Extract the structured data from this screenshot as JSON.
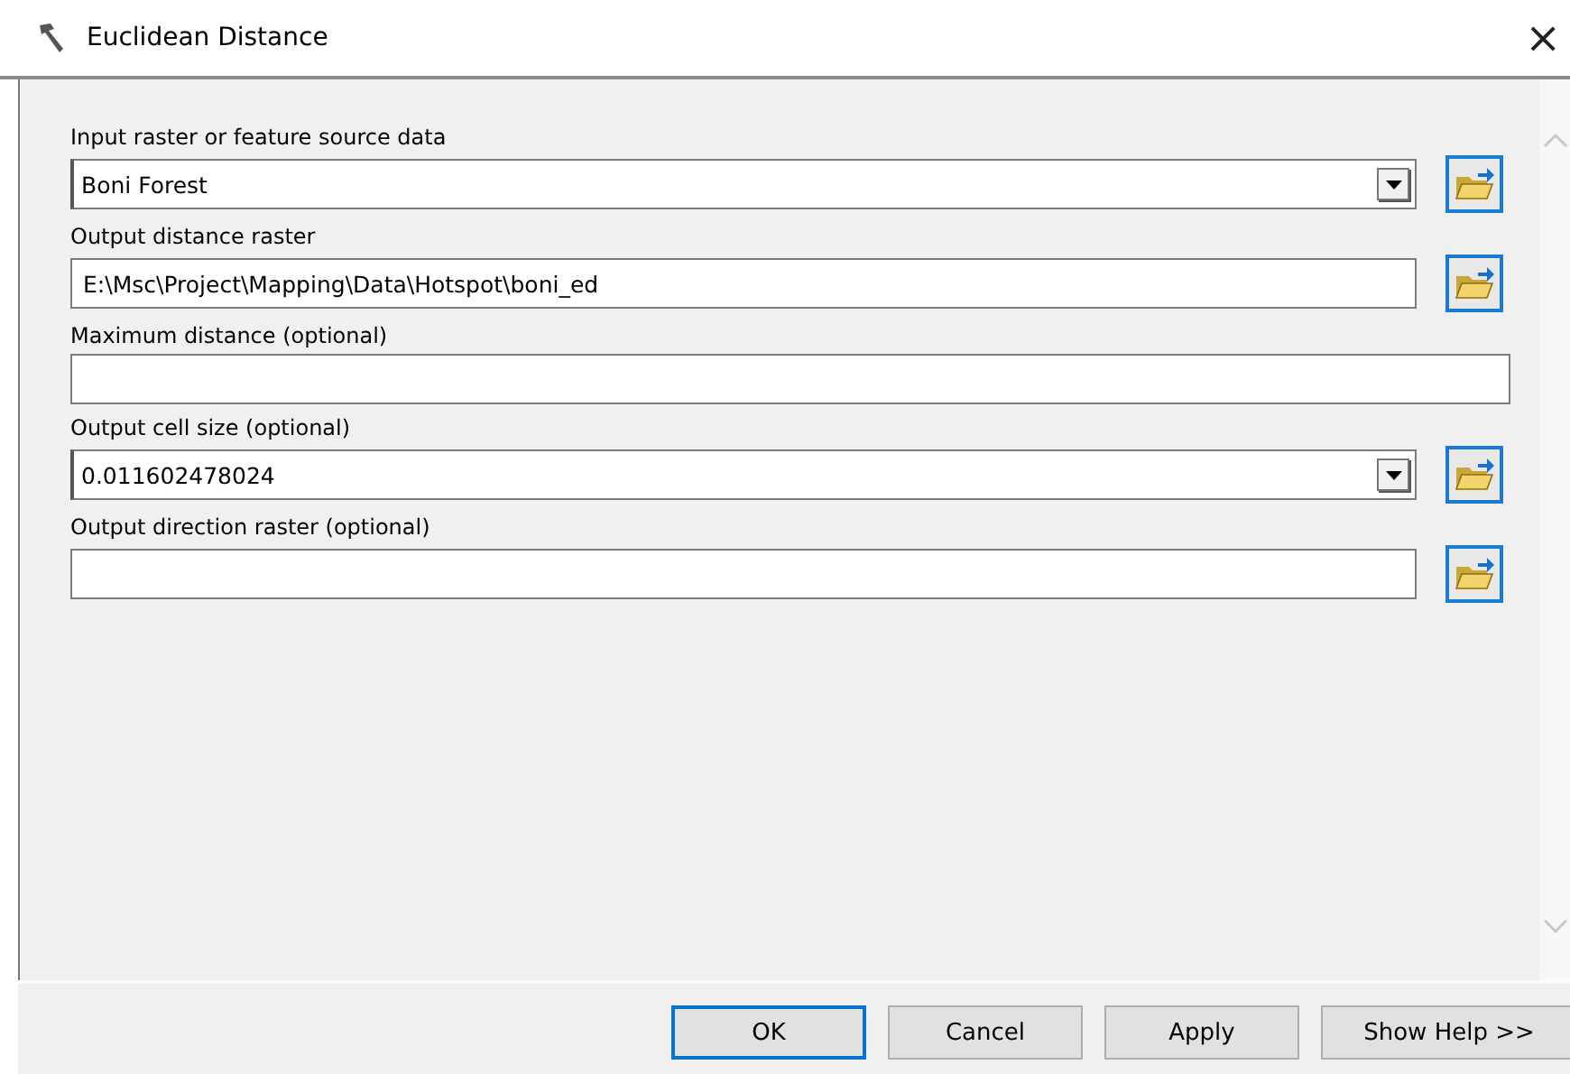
{
  "window": {
    "title": "Euclidean Distance",
    "close": "×"
  },
  "fields": [
    {
      "label": "Input raster or feature source data",
      "kind": "dropdown",
      "value": "Boni Forest",
      "browse": true
    },
    {
      "label": "Output distance raster",
      "kind": "text",
      "value": "E:\\Msc\\Project\\Mapping\\Data\\Hotspot\\boni_ed",
      "browse": true
    },
    {
      "label": "Maximum distance (optional)",
      "kind": "text",
      "browse": false
    },
    {
      "label": "Output cell size (optional)",
      "kind": "dropdown",
      "value": "0.011602478024",
      "browse": true
    },
    {
      "label": "Output direction raster (optional)",
      "kind": "text",
      "browse": true
    }
  ],
  "buttons": [
    {
      "label": "OK",
      "default": true
    },
    {
      "label": "Cancel",
      "default": false
    },
    {
      "label": "Apply",
      "default": false
    },
    {
      "label": "Show Help >>",
      "default": false
    }
  ]
}
